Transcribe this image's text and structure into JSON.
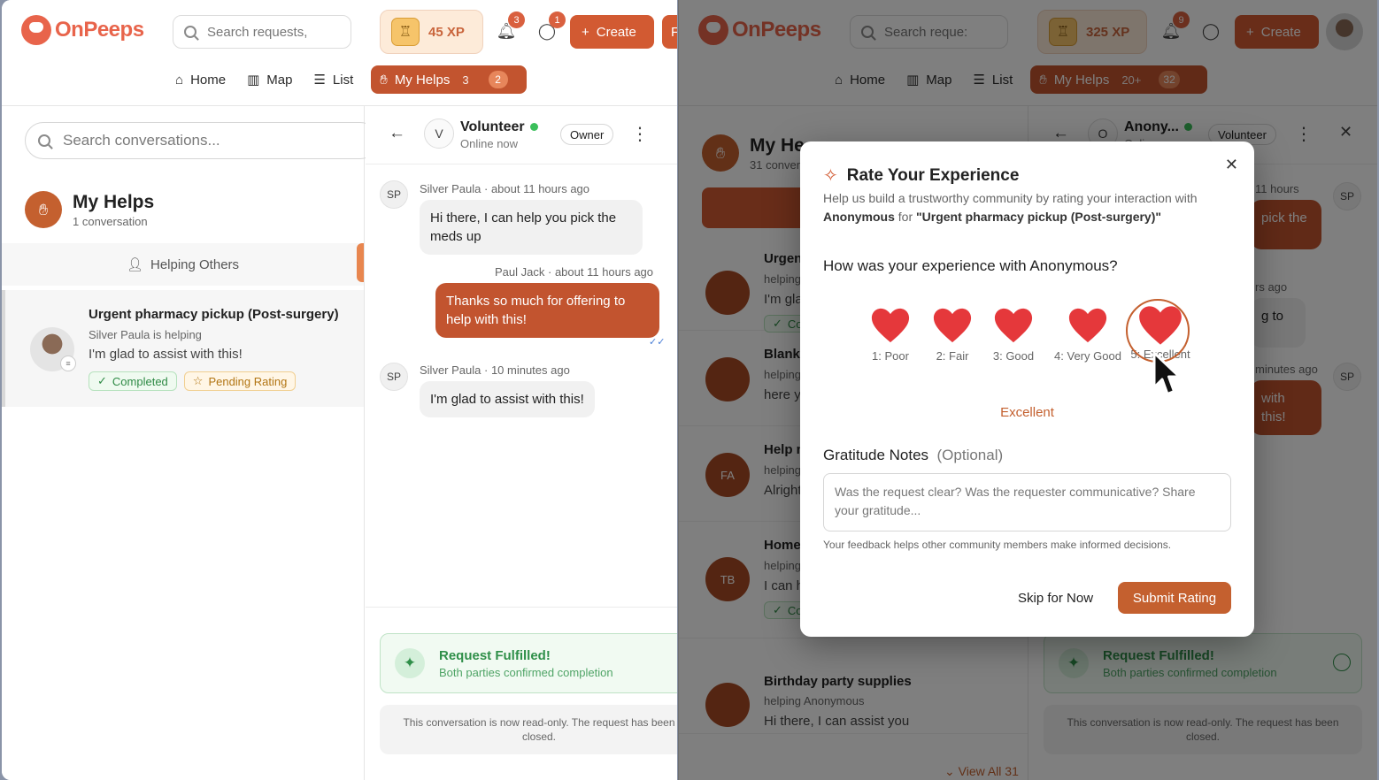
{
  "left": {
    "brand": "OnPeeps",
    "search_placeholder": "Search requests,",
    "xp": "45 XP",
    "notif_count": "3",
    "msg_count": "1",
    "create_label": "Create",
    "create_overflow_letter": "F",
    "nav": {
      "home": "Home",
      "map": "Map",
      "list": "List",
      "myhelps": "My Helps",
      "myhelps_count": "3",
      "myhelps_pill": "2"
    },
    "conv_search_placeholder": "Search conversations...",
    "list_title": "My Helps",
    "list_sub": "1 conversation",
    "filter_label": "Helping Others",
    "conversation": {
      "title": "Urgent pharmacy pickup (Post-surgery)",
      "sub": "Silver Paula is helping",
      "last_msg": "I'm glad to assist with this!",
      "tag_completed": "Completed",
      "tag_pending": "Pending Rating"
    },
    "chat": {
      "avatar_letter": "V",
      "name": "Volunteer",
      "status": "Online now",
      "role": "Owner",
      "messages": [
        {
          "initials": "SP",
          "sender": "Silver Paula",
          "time": "about 11 hours ago",
          "text": "Hi there, I can help you pick the meds up"
        },
        {
          "sender": "Paul Jack",
          "time": "about 11 hours ago",
          "text": "Thanks so much for offering to help with this!"
        },
        {
          "initials": "SP",
          "sender": "Silver Paula",
          "time": "10 minutes ago",
          "text": "I'm glad to assist with this!"
        }
      ],
      "fulfilled_title": "Request Fulfilled!",
      "fulfilled_sub": "Both parties confirmed completion",
      "readonly_text": "This conversation is now read-only. The request has been closed."
    }
  },
  "right": {
    "brand": "OnPeeps",
    "search_placeholder": "Search reque:",
    "xp": "325 XP",
    "notif_count": "9",
    "create_label": "Create",
    "nav": {
      "home": "Home",
      "map": "Map",
      "list": "List",
      "myhelps": "My Helps",
      "myhelps_count": "20+",
      "myhelps_pill": "32"
    },
    "list_title": "My He",
    "list_sub": "31 convers",
    "items": [
      {
        "title": "Urgen",
        "sub": "helping",
        "msg": "I'm gla",
        "tag": "Co",
        "initials": ""
      },
      {
        "title": "Blanke",
        "sub": "helping",
        "msg": "here y",
        "tag": "",
        "initials": ""
      },
      {
        "title": "Help n",
        "sub": "helping",
        "msg": "Alright",
        "tag": "",
        "initials": "FA"
      },
      {
        "title": "Home",
        "sub": "helping",
        "msg": "I can h",
        "tag": "Co",
        "initials": "TB"
      },
      {
        "title": "Birthday party supplies",
        "sub": "helping Anonymous",
        "msg": "Hi there, I can assist you",
        "tag": "",
        "initials": ""
      }
    ],
    "view_all": "View All 31",
    "chat": {
      "avatar_letter": "O",
      "name": "Anony...",
      "status": "Onli",
      "role": "Volunteer",
      "initials": "SP",
      "time1": "11 hours",
      "frag1": "pick the",
      "time2": "rs ago",
      "frag2": "g to",
      "time3": "minutes ago",
      "frag3": "with this!",
      "fulfilled_title": "Request Fulfilled!",
      "fulfilled_sub": "Both parties confirmed completion",
      "readonly_text": "This conversation is now read-only. The request has been closed."
    }
  },
  "modal": {
    "title": "Rate Your Experience",
    "desc_prefix": "Help us build a trustworthy community by rating your interaction with ",
    "desc_user": "Anonymous",
    "desc_mid": " for ",
    "desc_request": "\"Urgent pharmacy pickup (Post-surgery)\"",
    "question": "How was your experience with Anonymous?",
    "ratings": [
      "1: Poor",
      "2: Fair",
      "3: Good",
      "4: Very Good",
      "5: Excellent"
    ],
    "selected_rating": 5,
    "selected_label": "Excellent",
    "notes_label": "Gratitude Notes",
    "notes_optional": "(Optional)",
    "notes_placeholder": "Was the request clear? Was the requester communicative? Share your gratitude...",
    "help_text": "Your feedback helps other community members make informed decisions.",
    "skip_label": "Skip for Now",
    "submit_label": "Submit Rating"
  },
  "colors": {
    "brand": "#e8644b",
    "accent": "#c4602f",
    "success": "#2f8f49",
    "heart": "#e5383b"
  }
}
